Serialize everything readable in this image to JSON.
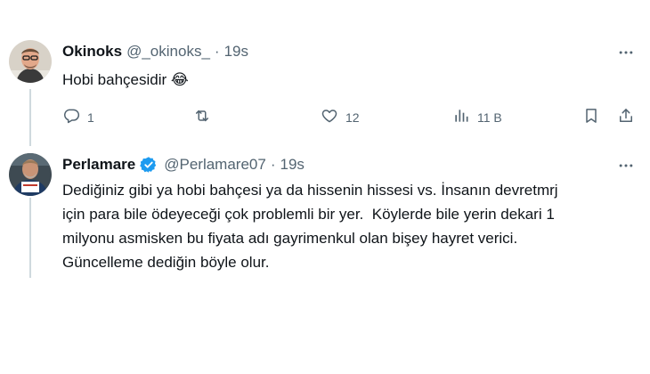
{
  "tweets": [
    {
      "author_name": "Okinoks",
      "handle": "@_okinoks_",
      "separator": "·",
      "time": "19s",
      "text": "Hobi bahçesidir 😂",
      "verified": false,
      "actions": {
        "replies": "1",
        "retweets": "",
        "likes": "12",
        "views": "11 B"
      }
    },
    {
      "author_name": "Perlamare",
      "handle": "@Perlamare07",
      "separator": "·",
      "time": "19s",
      "verified": true,
      "text": "Dediğiniz gibi ya hobi bahçesi ya da hissenin hissesi vs. İnsanın devretmrj\niçin para bile ödeyeceği çok problemli bir yer.  Köylerde bile yerin dekari 1\nmilyonu asmisken bu fiyata adı gayrimenkul olan bişey hayret verici.\nGüncelleme dediğin böyle olur."
    }
  ],
  "icons": {
    "more": "more-horizontal-icon",
    "reply": "reply-icon",
    "retweet": "retweet-icon",
    "like": "heart-icon",
    "views": "views-icon",
    "bookmark": "bookmark-icon",
    "share": "share-icon",
    "verified": "verified-badge-icon"
  },
  "colors": {
    "text_primary": "#0f1419",
    "text_secondary": "#536471",
    "verified_blue": "#1d9bf0",
    "thread_line": "#cfd9de"
  }
}
